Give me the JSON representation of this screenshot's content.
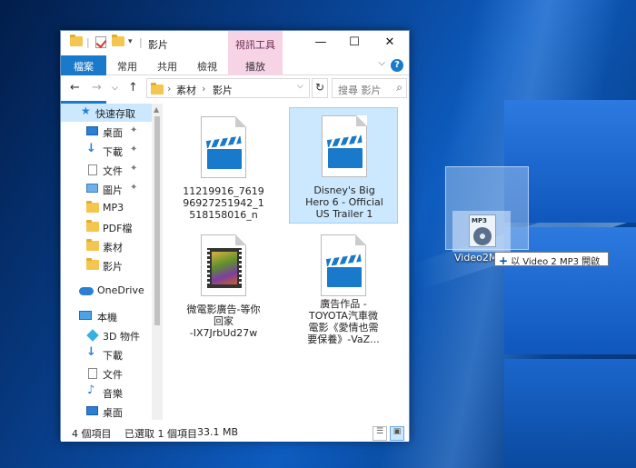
{
  "window": {
    "title": "影片",
    "context_tab": "視訊工具",
    "minimize": "—",
    "maximize": "☐",
    "close": "✕"
  },
  "ribbon": {
    "tabs": [
      "檔案",
      "常用",
      "共用",
      "檢視",
      "播放"
    ],
    "collapse": "⌵",
    "help": "?"
  },
  "nav": {
    "back": "←",
    "forward": "→",
    "recent": "⌵",
    "up": "↑"
  },
  "address": {
    "segments": [
      "素材",
      "影片"
    ],
    "separator": "›",
    "refresh": "↻"
  },
  "search": {
    "placeholder": "搜尋 影片",
    "icon": "search-icon"
  },
  "sidebar": {
    "items": [
      {
        "label": "快速存取",
        "icon": "star-icon",
        "pinned": false,
        "selected": true
      },
      {
        "label": "桌面",
        "icon": "desktop-icon",
        "pinned": true
      },
      {
        "label": "下載",
        "icon": "download-icon",
        "pinned": true
      },
      {
        "label": "文件",
        "icon": "document-icon",
        "pinned": true
      },
      {
        "label": "圖片",
        "icon": "pictures-icon",
        "pinned": true
      },
      {
        "label": "MP3",
        "icon": "folder-icon"
      },
      {
        "label": "PDF檔",
        "icon": "folder-icon"
      },
      {
        "label": "素材",
        "icon": "folder-icon"
      },
      {
        "label": "影片",
        "icon": "folder-icon"
      },
      {
        "label": "OneDrive",
        "icon": "cloud-icon"
      },
      {
        "label": "本機",
        "icon": "computer-icon"
      },
      {
        "label": "3D 物件",
        "icon": "cube-icon"
      },
      {
        "label": "下載",
        "icon": "download-icon"
      },
      {
        "label": "文件",
        "icon": "document-icon"
      },
      {
        "label": "音樂",
        "icon": "music-icon"
      },
      {
        "label": "桌面",
        "icon": "desktop-icon"
      }
    ],
    "pin_glyph": "📌"
  },
  "files": [
    {
      "name": "11219916_761996927251942_1518158016_n",
      "lines": [
        "11219916_7619",
        "96927251942_1",
        "518158016_n"
      ],
      "icon": "video-clapper-icon",
      "selected": false
    },
    {
      "name": "Disney's Big Hero 6 - Official US Trailer 1",
      "lines": [
        "Disney's Big",
        "Hero 6 - Official",
        "US Trailer 1"
      ],
      "icon": "video-clapper-icon",
      "selected": true
    },
    {
      "name": "微電影廣告-等你回家-IX7JrbUd27w",
      "lines": [
        "微電影廣告-等你",
        "回家",
        "-IX7JrbUd27w"
      ],
      "icon": "video-thumbnail-icon",
      "selected": false
    },
    {
      "name": "廣告作品 - TOYOTA汽車微電影《愛情也需要保養》-VaZ...",
      "lines": [
        "廣告作品 -",
        "TOYOTA汽車微",
        "電影《愛情也需",
        "要保養》-VaZ..."
      ],
      "icon": "video-clapper-icon",
      "selected": false
    }
  ],
  "status": {
    "count": "4 個項目",
    "selected": "已選取 1 個項目",
    "size": "33.1 MB"
  },
  "drag": {
    "app_label": "Video2M",
    "tooltip": "以 Video 2 MP3 開啟",
    "tooltip_plus": "+",
    "icon_tag": "MP3"
  },
  "colors": {
    "accent": "#1979ca",
    "context_tab": "#f7d3e6",
    "selection": "#cce8ff"
  }
}
